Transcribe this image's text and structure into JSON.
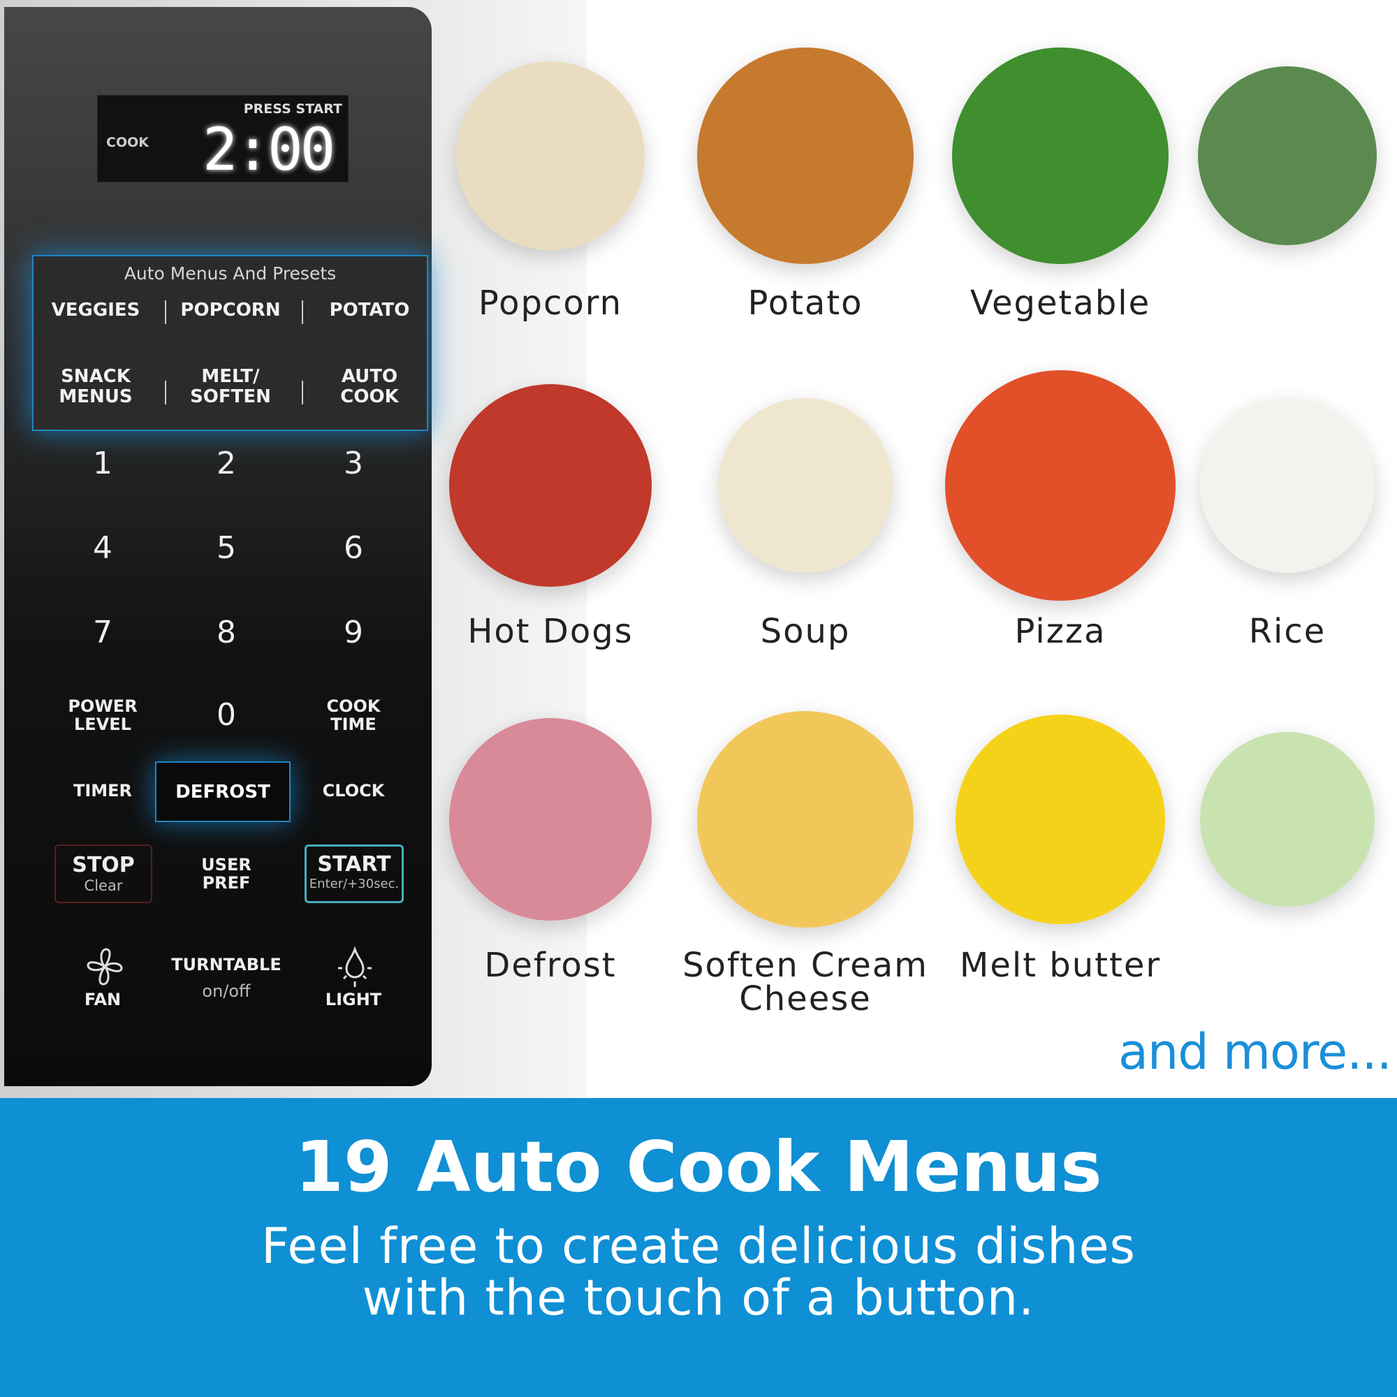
{
  "panel": {
    "display": {
      "mode": "COOK",
      "status": "PRESS START",
      "time": "2:00"
    },
    "auto_menu": {
      "title": "Auto Menus And Presets",
      "buttons": [
        "VEGGIES",
        "POPCORN",
        "POTATO",
        "SNACK\nMENUS",
        "MELT/\nSOFTEN",
        "AUTO\nCOOK"
      ]
    },
    "keypad": [
      "1",
      "2",
      "3",
      "4",
      "5",
      "6",
      "7",
      "8",
      "9",
      "0"
    ],
    "power_level": "POWER\nLEVEL",
    "cook_time": "COOK\nTIME",
    "timer": "TIMER",
    "defrost": "DEFROST",
    "clock": "CLOCK",
    "stop": {
      "label": "STOP",
      "sub": "Clear"
    },
    "user_pref": "USER\nPREF",
    "start": {
      "label": "START",
      "sub": "Enter/+30sec."
    },
    "fan": "FAN",
    "turntable": {
      "label": "TURNTABLE",
      "sub": "on/off"
    },
    "light": "LIGHT"
  },
  "foods": [
    {
      "label": "Popcorn",
      "color": "#eadcc0"
    },
    {
      "label": "Potato",
      "color": "#c67a2e"
    },
    {
      "label": "Vegetable",
      "color": "#3f8f2e"
    },
    {
      "label": "",
      "color": "#5b8a4e"
    },
    {
      "label": "Hot Dogs",
      "color": "#c0392b"
    },
    {
      "label": "Soup",
      "color": "#efe6cf"
    },
    {
      "label": "Pizza",
      "color": "#e2502a"
    },
    {
      "label": "Rice",
      "color": "#f4f2ec"
    },
    {
      "label": "Defrost",
      "color": "#d98a98"
    },
    {
      "label": "Soften Cream Cheese",
      "color": "#f2c75a"
    },
    {
      "label": "Melt butter",
      "color": "#f5d21a"
    },
    {
      "label": "",
      "color": "#c8e3b0"
    }
  ],
  "more": "and more...",
  "banner": {
    "title": "19 Auto Cook Menus",
    "subtitle_1": "Feel free to create delicious dishes",
    "subtitle_2": "with the touch of a button.",
    "color": "#0f8fd4"
  }
}
